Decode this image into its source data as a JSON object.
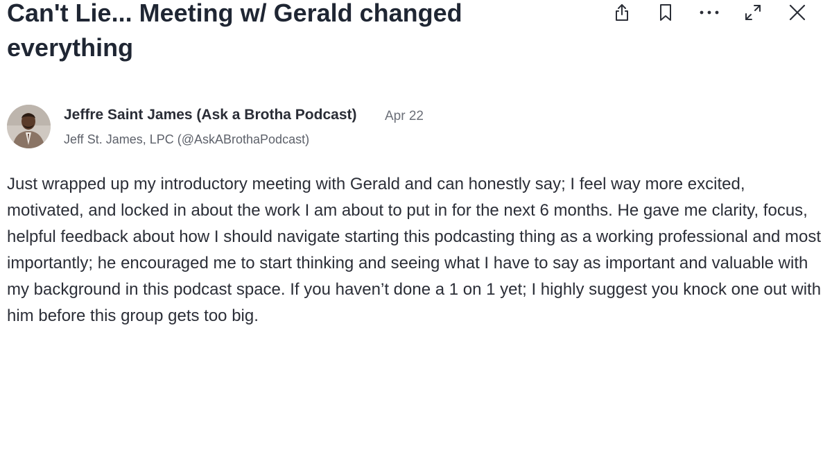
{
  "post": {
    "title": "Can't Lie... Meeting w/ Gerald changed everything",
    "author_name": "Jeffre Saint James (Ask a Brotha Podcast)",
    "date": "Apr 22",
    "author_subtitle": "Jeff St. James, LPC (@AskABrothaPodcast)",
    "body": "Just wrapped up my introductory meeting with Gerald and can honestly say; I feel way more excited, motivated, and locked in about the work I am about to put in for the next 6 months. He gave me clarity, focus, helpful feedback about how I should navigate starting this podcasting thing as a working professional and most importantly; he encouraged me to start thinking and seeing what I have to say as important and valuable with my background in this podcast space. If you haven’t done a 1 on 1 yet; I highly suggest you knock one out with him before this group gets too big."
  },
  "toolbar": {
    "icons": [
      "share-icon",
      "bookmark-icon",
      "more-icon",
      "expand-icon",
      "close-icon"
    ]
  }
}
